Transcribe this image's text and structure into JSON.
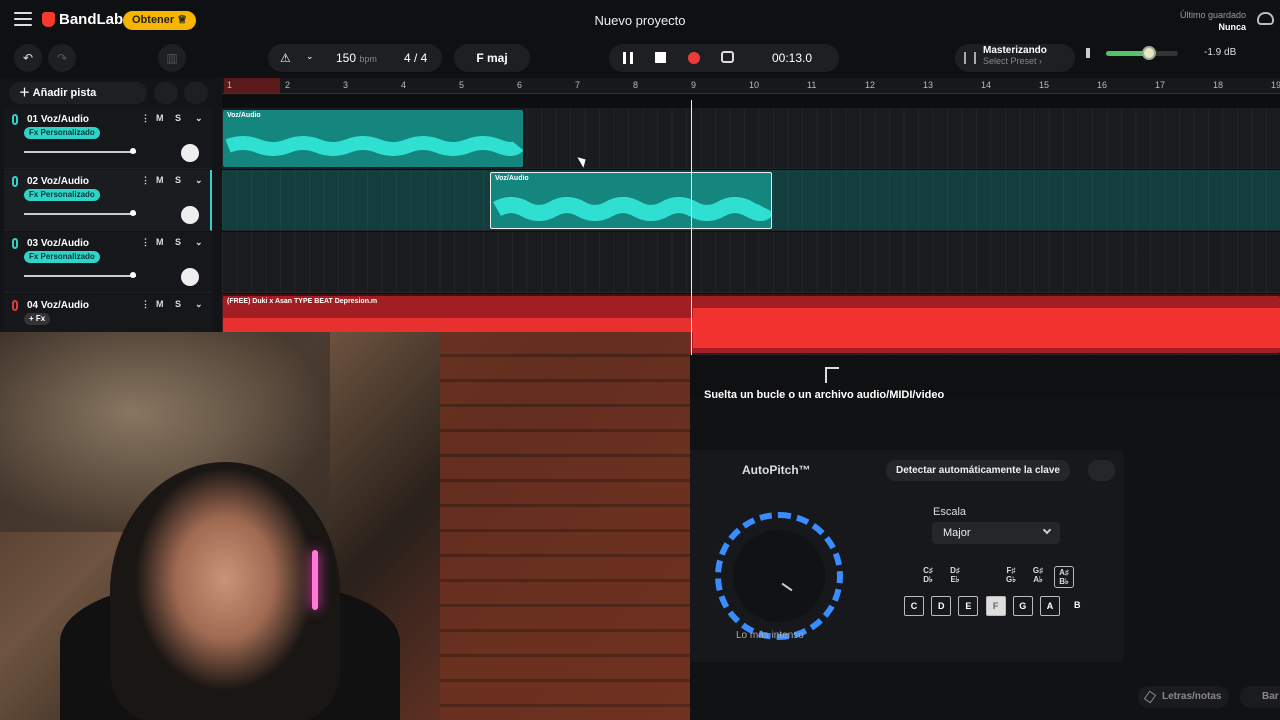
{
  "header": {
    "logo": "BandLab",
    "cta": "Obtener ♕",
    "title": "Nuevo proyecto",
    "saved_label": "Último guardado",
    "saved_value": "Nunca"
  },
  "toolbar": {
    "bpm": "150",
    "bpm_unit": "bpm",
    "time_sig": "4 / 4",
    "key": "F maj",
    "time": "00:13.0",
    "master_title": "Masterizando",
    "master_preset": "Select Preset ›",
    "volume_db": "-1.9 dB",
    "volume_level": 0.6
  },
  "tracks": [
    {
      "name": "01  Voz/Audio",
      "fx": "Fx Personalizado",
      "m": "M",
      "s": "S"
    },
    {
      "name": "02  Voz/Audio",
      "fx": "Fx Personalizado",
      "m": "M",
      "s": "S"
    },
    {
      "name": "03  Voz/Audio",
      "fx": "Fx Personalizado",
      "m": "M",
      "s": "S"
    },
    {
      "name": "04  Voz/Audio",
      "fx": "+ Fx",
      "m": "M",
      "s": "S"
    }
  ],
  "add_track": "Añadir pista",
  "ruler": [
    "1",
    "2",
    "3",
    "4",
    "5",
    "6",
    "7",
    "8",
    "9",
    "10",
    "11",
    "12",
    "13",
    "14",
    "15",
    "16",
    "17",
    "18",
    "19"
  ],
  "clips": {
    "c1": "Voz/Audio",
    "c2": "Voz/Audio",
    "c3": "(FREE) Duki x Asan TYPE BEAT Depresion.m"
  },
  "drop_text": "Suelta un bucle o un archivo audio/MIDI/video",
  "autopitch": {
    "title": "AutoPitch™",
    "detect": "Detectar automáticamente la clave",
    "dial_label": "Lo más intenso",
    "scale_label": "Escala",
    "scale_value": "Major",
    "sharps": [
      "C♯\nD♭",
      "D♯\nE♭",
      "F♯\nG♭",
      "G♯\nA♭",
      "A♯\nB♭"
    ],
    "naturals": [
      "C",
      "D",
      "E",
      "F",
      "G",
      "A",
      "B"
    ]
  },
  "bottom": {
    "lyrics": "Letras/notas",
    "bank": "Bar"
  },
  "colors": {
    "accent_teal": "#2fd3c8",
    "record_red": "#f03a3a",
    "cta_yellow": "#f7b500"
  }
}
